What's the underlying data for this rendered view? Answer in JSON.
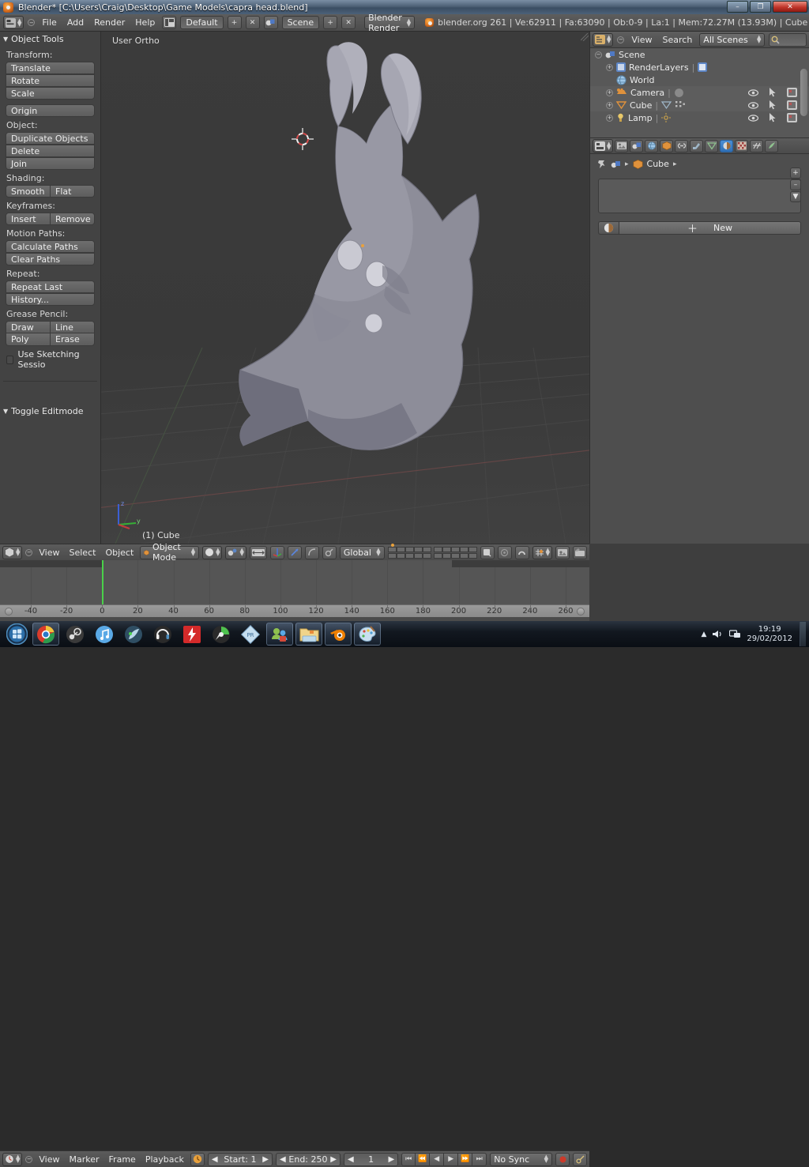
{
  "window": {
    "title": "Blender* [C:\\Users\\Craig\\Desktop\\Game Models\\capra head.blend]",
    "minimize": "–",
    "maximize": "❐",
    "close": "✕"
  },
  "topbar": {
    "menus": [
      "File",
      "Add",
      "Render",
      "Help"
    ],
    "screen_layout": "Default",
    "scene": "Scene",
    "engine": "Blender Render",
    "status": "blender.org 261 | Ve:62911 | Fa:63090 | Ob:0-9 | La:1 | Mem:72.27M (13.93M) | Cube",
    "add_label": "+",
    "remove_label": "✕"
  },
  "toolshelf": {
    "title": "Object Tools",
    "groups": [
      {
        "label": "Transform:",
        "buttons": [
          "Translate",
          "Rotate",
          "Scale"
        ]
      },
      {
        "label": "",
        "buttons": [
          "Origin"
        ]
      },
      {
        "label": "Object:",
        "buttons": [
          "Duplicate Objects",
          "Delete",
          "Join"
        ]
      },
      {
        "label": "Shading:",
        "pair": [
          "Smooth",
          "Flat"
        ]
      },
      {
        "label": "Keyframes:",
        "pair": [
          "Insert",
          "Remove"
        ]
      },
      {
        "label": "Motion Paths:",
        "buttons": [
          "Calculate Paths",
          "Clear Paths"
        ]
      },
      {
        "label": "Repeat:",
        "buttons": [
          "Repeat Last",
          "History..."
        ]
      },
      {
        "label": "Grease Pencil:",
        "pair": [
          "Draw",
          "Line"
        ],
        "pair2": [
          "Poly",
          "Erase"
        ]
      }
    ],
    "checkbox_label": "Use Sketching Sessio",
    "toggle_editmode": "Toggle Editmode"
  },
  "viewport": {
    "view_name": "User Ortho",
    "object_label": "(1) Cube",
    "axis_x": "x",
    "axis_y": "y",
    "axis_z": "z"
  },
  "viewport_footer": {
    "menus": [
      "View",
      "Select",
      "Object"
    ],
    "mode": "Object Mode",
    "transform_orientation": "Global"
  },
  "timeline": {
    "menus": [
      "View",
      "Marker",
      "Frame",
      "Playback"
    ],
    "start_label": "Start: 1",
    "end_label": "End: 250",
    "current_frame": "1",
    "sync_mode": "No Sync",
    "ticks": [
      "-40",
      "-20",
      "0",
      "20",
      "40",
      "60",
      "80",
      "100",
      "120",
      "140",
      "160",
      "180",
      "200",
      "220",
      "240",
      "260"
    ],
    "transport": [
      "⏮",
      "⏪",
      "◀",
      "▶",
      "⏩",
      "⏭"
    ]
  },
  "outliner": {
    "menus": [
      "View",
      "Search"
    ],
    "scene_filter": "All Scenes",
    "search_placeholder": "",
    "rows": [
      {
        "label": "Scene",
        "indent": 0,
        "icon": "scene-icon",
        "expander": "−"
      },
      {
        "label": "RenderLayers",
        "indent": 1,
        "icon": "renderlayers-icon",
        "expander": "+"
      },
      {
        "label": "World",
        "indent": 1,
        "icon": "world-icon",
        "expander": ""
      },
      {
        "label": "Camera",
        "indent": 1,
        "icon": "camera-icon",
        "expander": "+"
      },
      {
        "label": "Cube",
        "indent": 1,
        "icon": "mesh-icon",
        "expander": "+"
      },
      {
        "label": "Lamp",
        "indent": 1,
        "icon": "lamp-icon",
        "expander": "+"
      }
    ]
  },
  "properties": {
    "tabs": [
      "render-tab",
      "scene-tab",
      "world-tab",
      "object-tab",
      "constraints-tab",
      "modifiers-tab",
      "data-tab",
      "material-tab",
      "texture-tab",
      "particles-tab",
      "physics-tab"
    ],
    "active_tab": "material-tab",
    "breadcrumb_object": "Cube",
    "new_button": "New",
    "side_buttons": [
      "+",
      "–",
      "▼"
    ]
  },
  "taskbar": {
    "items": [
      "start-orb",
      "chrome",
      "steam",
      "itunes",
      "media-player",
      "headset-app",
      "red-lightning-app",
      "green-star-app",
      "diamond-app",
      "messenger",
      "explorer",
      "blender",
      "paint"
    ],
    "clock_time": "19:19",
    "clock_date": "29/02/2012"
  },
  "colors": {
    "accent_blue": "#3f7fc4",
    "blender_orange": "#e87d0d",
    "playhead_green": "#4ad14a",
    "axis_x": "#c23b3b",
    "axis_y": "#36b036",
    "axis_z": "#3b5fd4"
  }
}
